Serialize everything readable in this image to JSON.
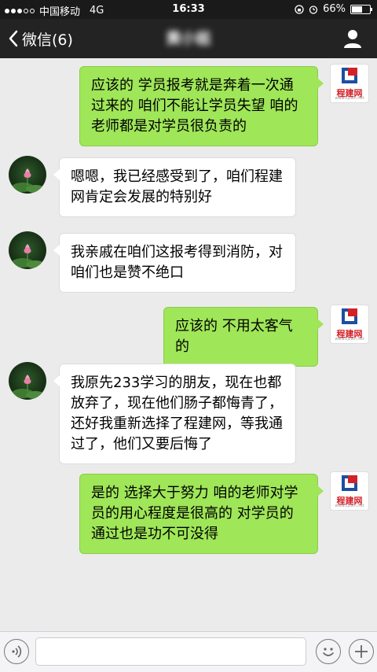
{
  "status_bar": {
    "carrier": "中国移动",
    "network": "4G",
    "time": "16:33",
    "battery": "66%",
    "battery_level": 0.66,
    "signal_strength": 3
  },
  "nav": {
    "back_label": "微信(6)",
    "title": "黄小姐"
  },
  "brand_avatar": {
    "logo_text": "程建网",
    "url": "www.cjzwn.net",
    "colors": {
      "red": "#d32128",
      "blue": "#1f4ea0"
    }
  },
  "messages": [
    {
      "side": "right",
      "avatar": "brand",
      "text": "应该的 学员报考就是奔着一次通过来的 咱们不能让学员失望 咱的老师都是对学员很负责的"
    },
    {
      "side": "left",
      "avatar": "lotus",
      "text": "嗯嗯，我已经感受到了，咱们程建网肯定会发展的特别好"
    },
    {
      "side": "left",
      "avatar": "lotus",
      "text": "我亲戚在咱们这报考得到消防，对咱们也是赞不绝口"
    },
    {
      "side": "right",
      "avatar": "brand",
      "text": "应该的 不用太客气的"
    },
    {
      "side": "left",
      "avatar": "lotus",
      "text": "我原先233学习的朋友，现在也都放弃了，现在他们肠子都悔青了，还好我重新选择了程建网，等我通过了，他们又要后悔了"
    },
    {
      "side": "right",
      "avatar": "brand",
      "text": "是的 选择大于努力 咱的老师对学员的用心程度是很高的 对学员的通过也是功不可没得"
    }
  ],
  "input_bar": {
    "value": "",
    "placeholder": ""
  },
  "colors": {
    "bubble_sent": "#9fe658",
    "bubble_received": "#ffffff",
    "background": "#ebebeb",
    "navbar": "#232323"
  }
}
